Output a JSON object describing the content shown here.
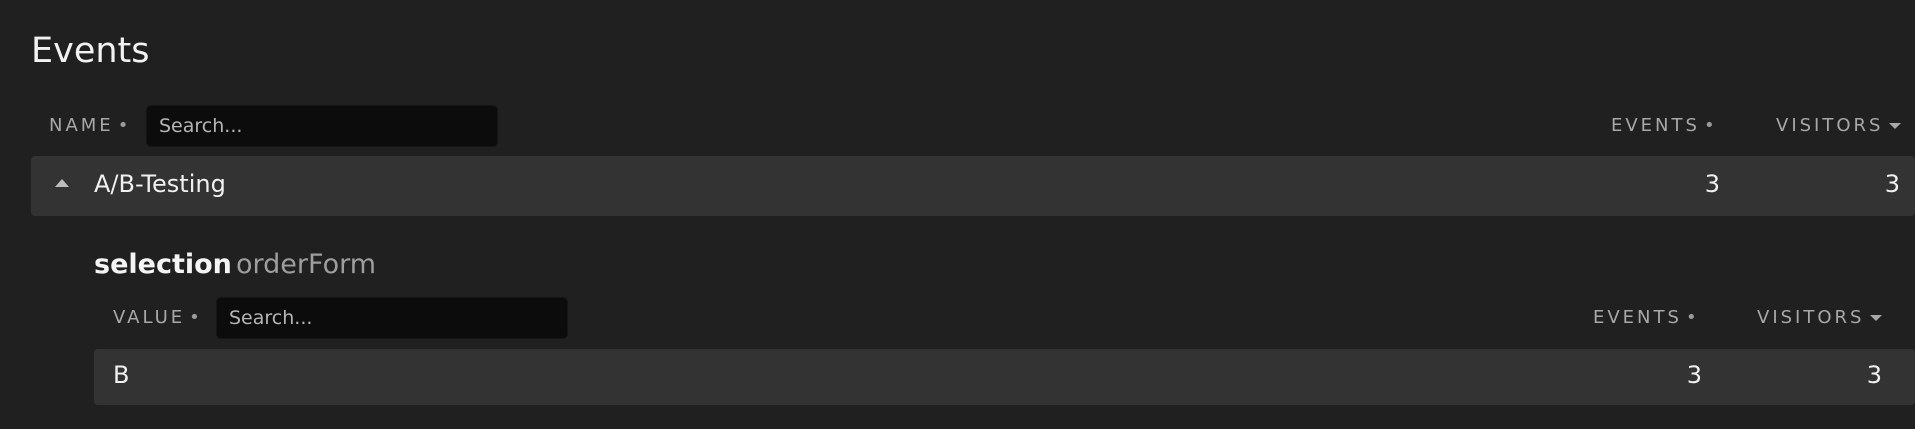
{
  "title": "Events",
  "table": {
    "columns": {
      "name": "NAME",
      "events": "EVENTS",
      "visitors": "VISITORS"
    },
    "search_placeholder": "Search...",
    "sort_dot": "•",
    "rows": [
      {
        "name": "A/B-Testing",
        "events": "3",
        "visitors": "3",
        "expanded": true,
        "detail": {
          "property_key": "selection",
          "property_value": "orderForm",
          "columns": {
            "value": "VALUE",
            "events": "EVENTS",
            "visitors": "VISITORS"
          },
          "search_placeholder": "Search...",
          "rows": [
            {
              "value": "B",
              "events": "3",
              "visitors": "3"
            }
          ]
        }
      }
    ]
  }
}
